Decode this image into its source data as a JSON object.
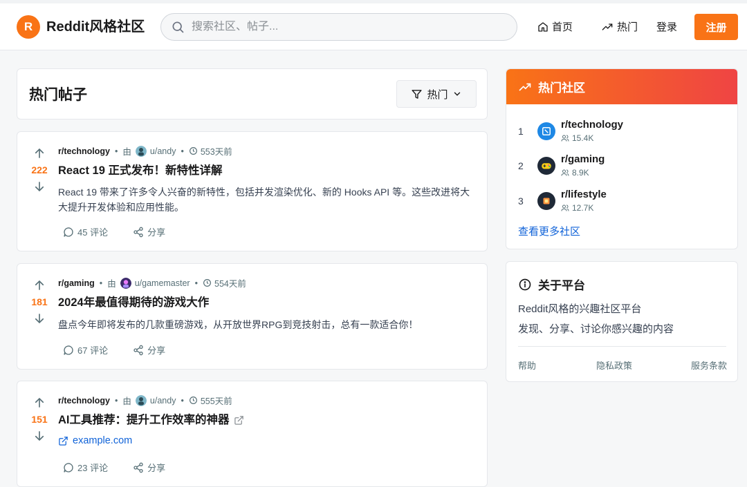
{
  "header": {
    "logo_letter": "R",
    "logo_text": "Reddit风格社区",
    "search_placeholder": "搜索社区、帖子...",
    "nav_home": "首页",
    "nav_hot": "热门",
    "login": "登录",
    "signup": "注册"
  },
  "feed": {
    "title": "热门帖子",
    "filter_label": "热门",
    "by_label": "由",
    "posts": [
      {
        "votes": "222",
        "subreddit": "r/technology",
        "author": "u/andy",
        "time": "553天前",
        "title": "React 19 正式发布！新特性详解",
        "body": "React 19 带来了许多令人兴奋的新特性，包括并发渲染优化、新的 Hooks API 等。这些改进将大大提升开发体验和应用性能。",
        "comments": "45 评论",
        "share": "分享"
      },
      {
        "votes": "181",
        "subreddit": "r/gaming",
        "author": "u/gamemaster",
        "time": "554天前",
        "title": "2024年最值得期待的游戏大作",
        "body": "盘点今年即将发布的几款重磅游戏，从开放世界RPG到竞技射击，总有一款适合你！",
        "comments": "67 评论",
        "share": "分享"
      },
      {
        "votes": "151",
        "subreddit": "r/technology",
        "author": "u/andy",
        "time": "555天前",
        "title": "AI工具推荐：提升工作效率的神器",
        "link": "example.com",
        "comments": "23 评论",
        "share": "分享"
      }
    ]
  },
  "sidebar": {
    "communities_title": "热门社区",
    "communities": [
      {
        "rank": "1",
        "name": "r/technology",
        "members": "15.4K"
      },
      {
        "rank": "2",
        "name": "r/gaming",
        "members": "8.9K"
      },
      {
        "rank": "3",
        "name": "r/lifestyle",
        "members": "12.7K"
      }
    ],
    "more_link": "查看更多社区",
    "about_title": "关于平台",
    "about_line1": "Reddit风格的兴趣社区平台",
    "about_line2": "发现、分享、讨论你感兴趣的内容",
    "footer": {
      "help": "帮助",
      "privacy": "隐私政策",
      "terms": "服务条款"
    }
  },
  "colors": {
    "accent": "#f97316",
    "gradient_end": "#ef4444",
    "link": "#0f62d8"
  }
}
